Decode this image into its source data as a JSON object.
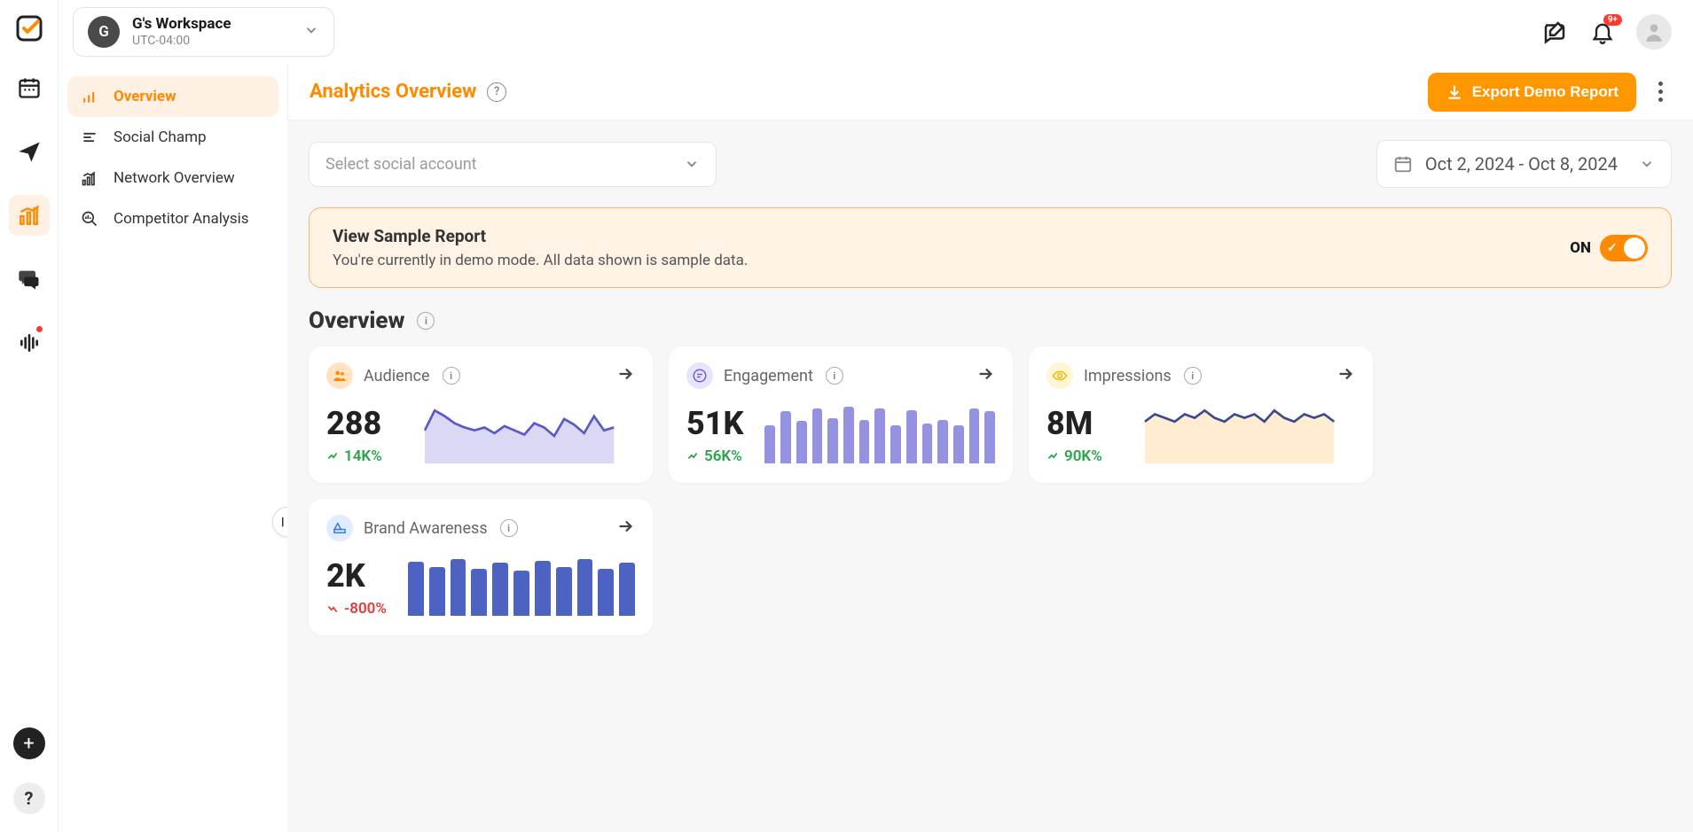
{
  "workspace": {
    "avatar_letter": "G",
    "name": "G's Workspace",
    "timezone": "UTC-04:00"
  },
  "topbar": {
    "notif_badge": "9+"
  },
  "sidenav": {
    "items": [
      {
        "label": "Overview",
        "active": true
      },
      {
        "label": "Social Champ",
        "active": false
      },
      {
        "label": "Network Overview",
        "active": false
      },
      {
        "label": "Competitor Analysis",
        "active": false
      }
    ]
  },
  "page": {
    "title": "Analytics Overview",
    "export_label": "Export Demo Report",
    "account_placeholder": "Select social account",
    "date_range": "Oct 2, 2024 - Oct 8, 2024"
  },
  "banner": {
    "title": "View Sample Report",
    "subtitle": "You're currently in demo mode. All data shown is sample data.",
    "toggle_label": "ON"
  },
  "section": {
    "title": "Overview"
  },
  "cards": [
    {
      "name": "Audience",
      "value": "288",
      "change": "14K%",
      "trend": "up",
      "icon": "orange",
      "viz": "line"
    },
    {
      "name": "Engagement",
      "value": "51K",
      "change": "56K%",
      "trend": "up",
      "icon": "purple",
      "viz": "bars_soft"
    },
    {
      "name": "Impressions",
      "value": "8M",
      "change": "90K%",
      "trend": "up",
      "icon": "yellow",
      "viz": "area"
    },
    {
      "name": "Brand Awareness",
      "value": "2K",
      "change": "-800%",
      "trend": "down",
      "icon": "blue",
      "viz": "bars_blue"
    }
  ],
  "chart_data": [
    {
      "type": "line",
      "card": "Audience",
      "values": [
        20,
        34,
        30,
        25,
        22,
        20,
        22,
        18,
        23,
        20,
        17,
        25,
        22,
        16,
        28,
        24,
        18,
        30,
        20,
        22
      ]
    },
    {
      "type": "bar",
      "card": "Engagement",
      "values": [
        40,
        55,
        45,
        58,
        48,
        60,
        46,
        58,
        40,
        56,
        42,
        46,
        40,
        58,
        55
      ]
    },
    {
      "type": "area",
      "card": "Impressions",
      "values": [
        10,
        12,
        11,
        10,
        12,
        11,
        13,
        11,
        10,
        12,
        11,
        12,
        10,
        13,
        11,
        10,
        12,
        11,
        12,
        10
      ]
    },
    {
      "type": "bar",
      "card": "Brand Awareness",
      "values": [
        55,
        50,
        58,
        48,
        54,
        46,
        56,
        50,
        58,
        48,
        54
      ]
    }
  ]
}
